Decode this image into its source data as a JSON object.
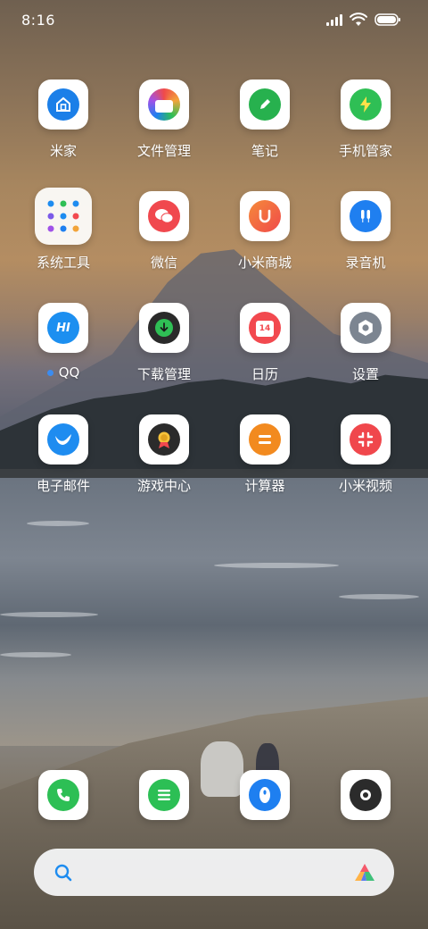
{
  "status_bar": {
    "time": "8:16",
    "icons": [
      "signal-icon",
      "wifi-icon",
      "battery-icon"
    ]
  },
  "apps": [
    {
      "label": "米家",
      "icon": "mijia-home-icon",
      "color": "#1b7fe8"
    },
    {
      "label": "文件管理",
      "icon": "file-manager-icon",
      "color": "#f2a43a"
    },
    {
      "label": "笔记",
      "icon": "notes-pencil-icon",
      "color": "#27b14e"
    },
    {
      "label": "手机管家",
      "icon": "security-bolt-icon",
      "color": "#2fbf55"
    },
    {
      "label": "系统工具",
      "icon": "folder-icon",
      "color": "#ffffff"
    },
    {
      "label": "微信",
      "icon": "wechat-icon",
      "color": "#f0484e"
    },
    {
      "label": "小米商城",
      "icon": "mi-store-icon",
      "color": "#f2663a"
    },
    {
      "label": "录音机",
      "icon": "recorder-icon",
      "color": "#1f7ff0"
    },
    {
      "label": "QQ",
      "icon": "qq-hi-icon",
      "color": "#1c8ff0",
      "has_new_dot": true
    },
    {
      "label": "下载管理",
      "icon": "download-icon",
      "color": "#2a2a2a"
    },
    {
      "label": "日历",
      "icon": "calendar-icon",
      "color": "#f2494f",
      "badge_text": "14"
    },
    {
      "label": "设置",
      "icon": "settings-gear-icon",
      "color": "#7c8591"
    },
    {
      "label": "电子邮件",
      "icon": "email-bird-icon",
      "color": "#1e8cf0"
    },
    {
      "label": "游戏中心",
      "icon": "game-center-medal-icon",
      "color": "#2b2b2b"
    },
    {
      "label": "计算器",
      "icon": "calculator-icon",
      "color": "#f28a1f"
    },
    {
      "label": "小米视频",
      "icon": "mi-video-icon",
      "color": "#f0474c"
    }
  ],
  "dock": [
    {
      "icon": "phone-icon",
      "color": "#2dbf55"
    },
    {
      "icon": "messages-icon",
      "color": "#2cbf55"
    },
    {
      "icon": "browser-icon",
      "color": "#1e7ff0"
    },
    {
      "icon": "camera-icon",
      "color": "#2b2b2b"
    }
  ],
  "search": {
    "icon": "search-icon",
    "assistant_icon": "xiaoai-assistant-icon"
  }
}
